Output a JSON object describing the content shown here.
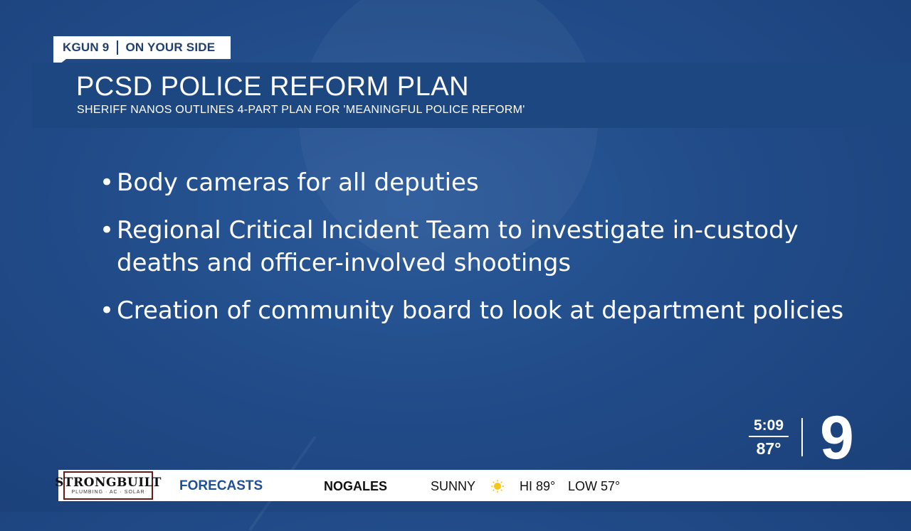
{
  "tag": {
    "station": "KGUN 9",
    "slogan": "ON YOUR SIDE"
  },
  "headline": "PCSD POLICE REFORM PLAN",
  "subhead": "SHERIFF NANOS OUTLINES 4-PART PLAN FOR 'MEANINGFUL POLICE REFORM'",
  "bullets": [
    "Body cameras for all deputies",
    "Regional Critical Incident Team to investigate in-custody deaths and officer-involved shootings",
    "Creation of community board to look at department policies"
  ],
  "bullet_glyph": "•",
  "clock": {
    "time": "5:09",
    "temp": "87°"
  },
  "logo": "9",
  "ticker": {
    "sponsor_name": "STRONGBUILT",
    "sponsor_sub": "PLUMBING · AC · SOLAR",
    "label": "FORECASTS",
    "city": "NOGALES",
    "condition": "SUNNY",
    "condition_icon": "sun-icon",
    "high": "HI 89°",
    "low": "LOW 57°"
  },
  "colors": {
    "background": "#214c89",
    "title_bar": "#1d4780",
    "accent": "#1f4f99",
    "sun": "#f5c518"
  }
}
